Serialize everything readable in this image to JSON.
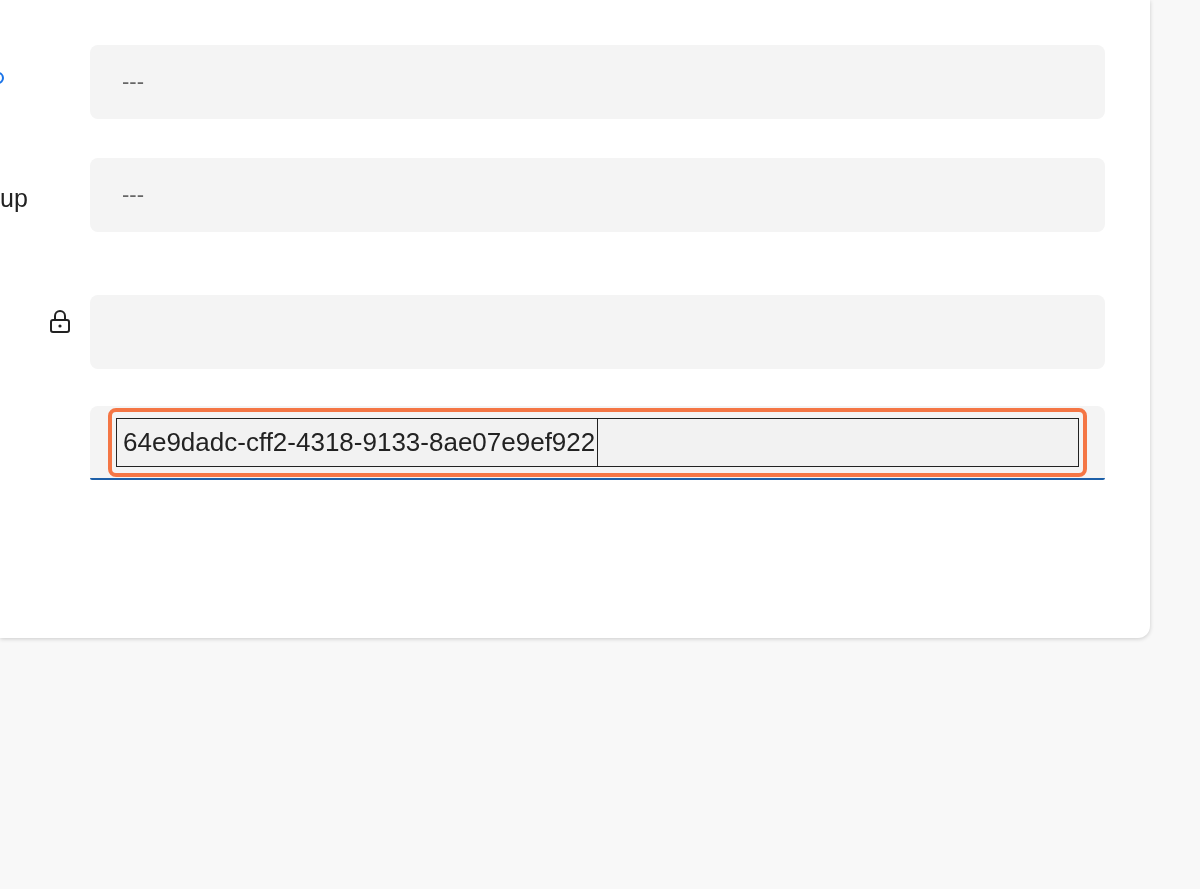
{
  "fields": [
    {
      "kind": "cut-icon",
      "value": "---"
    },
    {
      "kind": "label",
      "label": "up",
      "value": "---"
    },
    {
      "kind": "locked"
    },
    {
      "kind": "editable",
      "value": "64e9dadc-cff2-4318-9133-8ae07e9ef922",
      "focused": true,
      "highlighted": true
    }
  ]
}
